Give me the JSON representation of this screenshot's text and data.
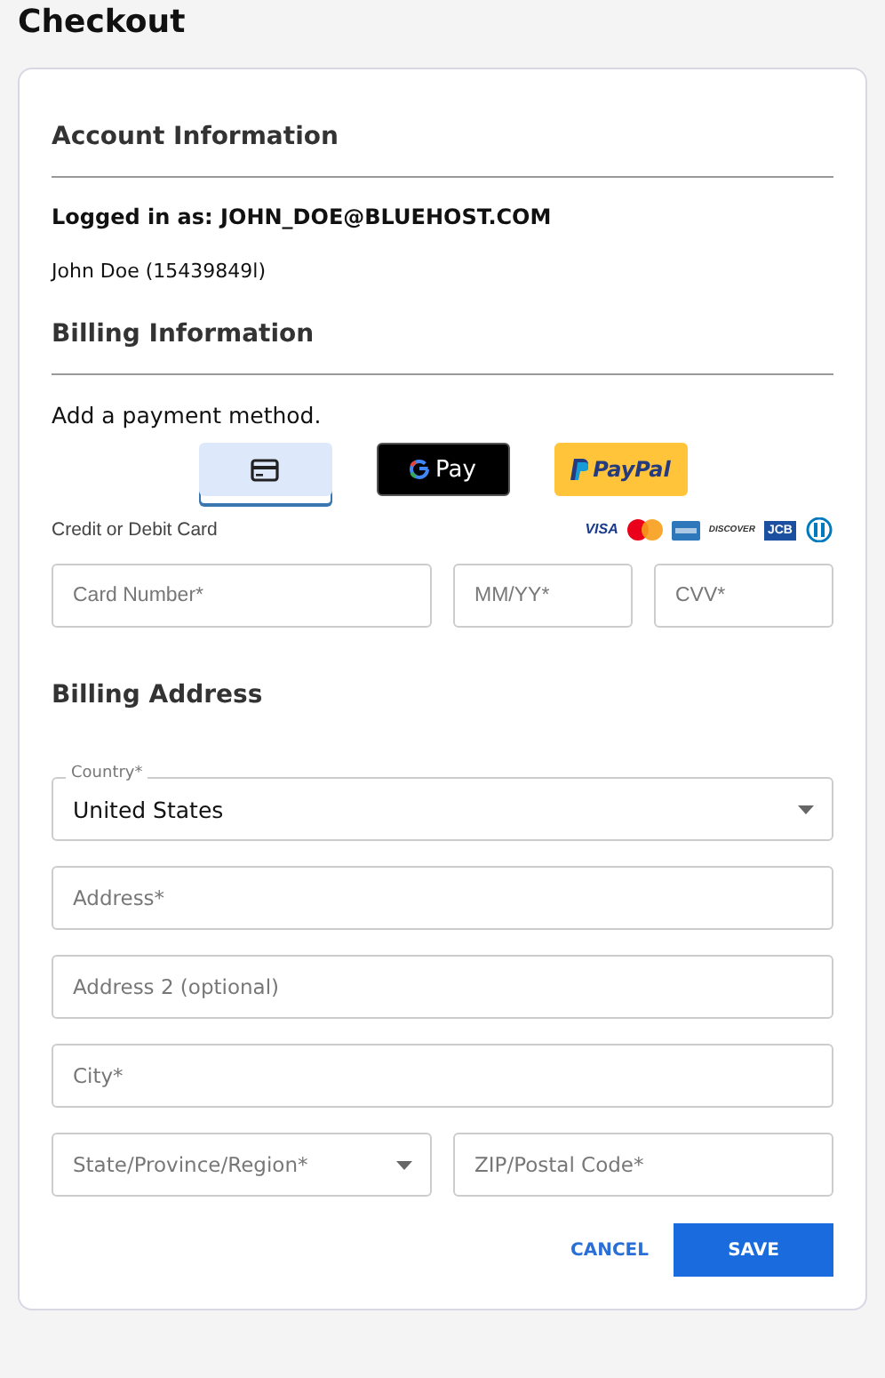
{
  "page_title": "Checkout",
  "account": {
    "heading": "Account Information",
    "logged_in": "Logged in as: JOHN_DOE@BLUEHOST.COM",
    "name": "John Doe (15439849l)"
  },
  "billing": {
    "heading": "Billing Information",
    "prompt": "Add a payment method.",
    "methods": [
      {
        "kind": "card",
        "selected": true
      },
      {
        "kind": "gpay",
        "label": "Pay",
        "selected": false
      },
      {
        "kind": "paypal",
        "label": "PayPal",
        "selected": false
      }
    ],
    "card_label": "Credit or Debit Card",
    "brands": [
      {
        "kind": "visa",
        "label": "VISA"
      },
      {
        "kind": "mastercard"
      },
      {
        "kind": "amex"
      },
      {
        "kind": "discover",
        "label": "DISCOVER"
      },
      {
        "kind": "jcb",
        "label": "JCB"
      },
      {
        "kind": "diners"
      }
    ],
    "card_fields": [
      {
        "placeholder": "Card Number*"
      },
      {
        "placeholder": "MM/YY*"
      },
      {
        "placeholder": "CVV*"
      }
    ]
  },
  "address": {
    "heading": "Billing Address",
    "rows": [
      [
        {
          "kind": "select",
          "label": "Country*",
          "value": "United States"
        }
      ],
      [
        {
          "kind": "input",
          "placeholder": "Address*"
        }
      ],
      [
        {
          "kind": "input",
          "placeholder": "Address 2 (optional)"
        }
      ],
      [
        {
          "kind": "input",
          "placeholder": "City*"
        }
      ],
      [
        {
          "kind": "select",
          "placeholder": "State/Province/Region*"
        },
        {
          "kind": "input",
          "placeholder": "ZIP/Postal Code*"
        }
      ]
    ]
  },
  "actions": {
    "cancel": "CANCEL",
    "save": "SAVE"
  }
}
